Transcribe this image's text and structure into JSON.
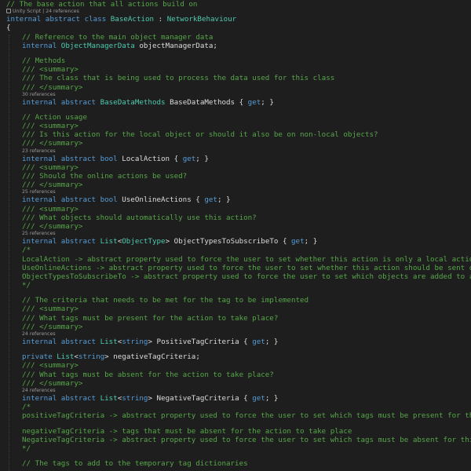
{
  "editor": {
    "colors": {
      "background": "#1e1e1e",
      "comment": "#57a64a",
      "keyword": "#569cd6",
      "type": "#4ec9b0",
      "plain": "#dcdcdc",
      "codelens": "#999999"
    },
    "lines": [
      {
        "kind": "code",
        "indent": 1,
        "tokens": [
          {
            "t": "comment",
            "v": "// The base action that all actions build on"
          }
        ]
      },
      {
        "kind": "lens",
        "indent": 1,
        "icon": "unity-script-icon",
        "text": "Unity Script | 24 references"
      },
      {
        "kind": "code",
        "indent": 1,
        "tokens": [
          {
            "t": "keyword",
            "v": "internal abstract class "
          },
          {
            "t": "type",
            "v": "BaseAction"
          },
          {
            "t": "plain",
            "v": " : "
          },
          {
            "t": "type",
            "v": "NetworkBehaviour"
          }
        ]
      },
      {
        "kind": "code",
        "indent": 1,
        "tokens": [
          {
            "t": "plain",
            "v": "{"
          }
        ]
      },
      {
        "kind": "code",
        "indent": 2,
        "tokens": [
          {
            "t": "comment",
            "v": "// Reference to the main object manager data"
          }
        ]
      },
      {
        "kind": "code",
        "indent": 2,
        "tokens": [
          {
            "t": "keyword",
            "v": "internal "
          },
          {
            "t": "type",
            "v": "ObjectManagerData"
          },
          {
            "t": "plain",
            "v": " objectManagerData;"
          }
        ]
      },
      {
        "kind": "blank"
      },
      {
        "kind": "code",
        "indent": 2,
        "tokens": [
          {
            "t": "comment",
            "v": "// Methods"
          }
        ]
      },
      {
        "kind": "code",
        "indent": 2,
        "tokens": [
          {
            "t": "comment",
            "v": "/// <summary>"
          }
        ]
      },
      {
        "kind": "code",
        "indent": 2,
        "tokens": [
          {
            "t": "comment",
            "v": "/// The class that is being used to process the data used for this class"
          }
        ]
      },
      {
        "kind": "code",
        "indent": 2,
        "tokens": [
          {
            "t": "comment",
            "v": "/// </summary>"
          }
        ]
      },
      {
        "kind": "lens",
        "indent": 2,
        "text": "30 references"
      },
      {
        "kind": "code",
        "indent": 2,
        "tokens": [
          {
            "t": "keyword",
            "v": "internal abstract "
          },
          {
            "t": "type",
            "v": "BaseDataMethods"
          },
          {
            "t": "plain",
            "v": " BaseDataMethods { "
          },
          {
            "t": "keyword",
            "v": "get"
          },
          {
            "t": "plain",
            "v": "; }"
          }
        ]
      },
      {
        "kind": "blank"
      },
      {
        "kind": "code",
        "indent": 2,
        "tokens": [
          {
            "t": "comment",
            "v": "// Action usage"
          }
        ]
      },
      {
        "kind": "code",
        "indent": 2,
        "tokens": [
          {
            "t": "comment",
            "v": "/// <summary>"
          }
        ]
      },
      {
        "kind": "code",
        "indent": 2,
        "tokens": [
          {
            "t": "comment",
            "v": "/// Is this action for the local object or should it also be on non-local objects?"
          }
        ]
      },
      {
        "kind": "code",
        "indent": 2,
        "tokens": [
          {
            "t": "comment",
            "v": "/// </summary>"
          }
        ]
      },
      {
        "kind": "lens",
        "indent": 2,
        "text": "23 references"
      },
      {
        "kind": "code",
        "indent": 2,
        "tokens": [
          {
            "t": "keyword",
            "v": "internal abstract bool "
          },
          {
            "t": "plain",
            "v": "LocalAction { "
          },
          {
            "t": "keyword",
            "v": "get"
          },
          {
            "t": "plain",
            "v": "; }"
          }
        ]
      },
      {
        "kind": "code",
        "indent": 2,
        "tokens": [
          {
            "t": "comment",
            "v": "/// <summary>"
          }
        ]
      },
      {
        "kind": "code",
        "indent": 2,
        "tokens": [
          {
            "t": "comment",
            "v": "/// Should the online actions be used?"
          }
        ]
      },
      {
        "kind": "code",
        "indent": 2,
        "tokens": [
          {
            "t": "comment",
            "v": "/// </summary>"
          }
        ]
      },
      {
        "kind": "lens",
        "indent": 2,
        "text": "25 references"
      },
      {
        "kind": "code",
        "indent": 2,
        "tokens": [
          {
            "t": "keyword",
            "v": "internal abstract bool "
          },
          {
            "t": "plain",
            "v": "UseOnlineActions { "
          },
          {
            "t": "keyword",
            "v": "get"
          },
          {
            "t": "plain",
            "v": "; }"
          }
        ]
      },
      {
        "kind": "code",
        "indent": 2,
        "tokens": [
          {
            "t": "comment",
            "v": "/// <summary>"
          }
        ]
      },
      {
        "kind": "code",
        "indent": 2,
        "tokens": [
          {
            "t": "comment",
            "v": "/// What objects should automatically use this action?"
          }
        ]
      },
      {
        "kind": "code",
        "indent": 2,
        "tokens": [
          {
            "t": "comment",
            "v": "/// </summary>"
          }
        ]
      },
      {
        "kind": "lens",
        "indent": 2,
        "text": "25 references"
      },
      {
        "kind": "code",
        "indent": 2,
        "tokens": [
          {
            "t": "keyword",
            "v": "internal abstract "
          },
          {
            "t": "type",
            "v": "List"
          },
          {
            "t": "plain",
            "v": "<"
          },
          {
            "t": "type",
            "v": "ObjectType"
          },
          {
            "t": "plain",
            "v": "> ObjectTypesToSubscribeTo { "
          },
          {
            "t": "keyword",
            "v": "get"
          },
          {
            "t": "plain",
            "v": "; }"
          }
        ]
      },
      {
        "kind": "code",
        "indent": 2,
        "tokens": [
          {
            "t": "comment",
            "v": "/*"
          }
        ]
      },
      {
        "kind": "code",
        "indent": 2,
        "tokens": [
          {
            "t": "comment",
            "v": "LocalAction -> abstract property used to force the user to set whether this action is only a local action (meaning"
          }
        ]
      },
      {
        "kind": "code",
        "indent": 2,
        "tokens": [
          {
            "t": "comment",
            "v": "UseOnlineActions -> abstract property used to force the user to set whether this action should be sent out to the"
          }
        ]
      },
      {
        "kind": "code",
        "indent": 2,
        "tokens": [
          {
            "t": "comment",
            "v": "ObjectTypesToSubscribeTo -> abstract property used to force the user to set which objects are added to an action"
          }
        ]
      },
      {
        "kind": "code",
        "indent": 2,
        "tokens": [
          {
            "t": "comment",
            "v": "*/"
          }
        ]
      },
      {
        "kind": "blank"
      },
      {
        "kind": "code",
        "indent": 2,
        "tokens": [
          {
            "t": "comment",
            "v": "// The criteria that needs to be met for the tag to be implemented"
          }
        ]
      },
      {
        "kind": "code",
        "indent": 2,
        "tokens": [
          {
            "t": "comment",
            "v": "/// <summary>"
          }
        ]
      },
      {
        "kind": "code",
        "indent": 2,
        "tokens": [
          {
            "t": "comment",
            "v": "/// What tags must be present for the action to take place?"
          }
        ]
      },
      {
        "kind": "code",
        "indent": 2,
        "tokens": [
          {
            "t": "comment",
            "v": "/// </summary>"
          }
        ]
      },
      {
        "kind": "lens",
        "indent": 2,
        "text": "24 references"
      },
      {
        "kind": "code",
        "indent": 2,
        "tokens": [
          {
            "t": "keyword",
            "v": "internal abstract "
          },
          {
            "t": "type",
            "v": "List"
          },
          {
            "t": "plain",
            "v": "<"
          },
          {
            "t": "keyword",
            "v": "string"
          },
          {
            "t": "plain",
            "v": "> PositiveTagCriteria { "
          },
          {
            "t": "keyword",
            "v": "get"
          },
          {
            "t": "plain",
            "v": "; }"
          }
        ]
      },
      {
        "kind": "blank"
      },
      {
        "kind": "code",
        "indent": 2,
        "tokens": [
          {
            "t": "keyword",
            "v": "private "
          },
          {
            "t": "type",
            "v": "List"
          },
          {
            "t": "plain",
            "v": "<"
          },
          {
            "t": "keyword",
            "v": "string"
          },
          {
            "t": "plain",
            "v": "> negativeTagCriteria;"
          }
        ]
      },
      {
        "kind": "code",
        "indent": 2,
        "tokens": [
          {
            "t": "comment",
            "v": "/// <summary>"
          }
        ]
      },
      {
        "kind": "code",
        "indent": 2,
        "tokens": [
          {
            "t": "comment",
            "v": "/// What tags must be absent for the action to take place?"
          }
        ]
      },
      {
        "kind": "code",
        "indent": 2,
        "tokens": [
          {
            "t": "comment",
            "v": "/// </summary>"
          }
        ]
      },
      {
        "kind": "lens",
        "indent": 2,
        "text": "24 references"
      },
      {
        "kind": "code",
        "indent": 2,
        "tokens": [
          {
            "t": "keyword",
            "v": "internal abstract "
          },
          {
            "t": "type",
            "v": "List"
          },
          {
            "t": "plain",
            "v": "<"
          },
          {
            "t": "keyword",
            "v": "string"
          },
          {
            "t": "plain",
            "v": "> NegativeTagCriteria { "
          },
          {
            "t": "keyword",
            "v": "get"
          },
          {
            "t": "plain",
            "v": "; }"
          }
        ]
      },
      {
        "kind": "code",
        "indent": 2,
        "tokens": [
          {
            "t": "comment",
            "v": "/*"
          }
        ]
      },
      {
        "kind": "code",
        "indent": 2,
        "tokens": [
          {
            "t": "comment",
            "v": "positiveTagCriteria -> abstract property used to force the user to set which tags must be present for this action"
          }
        ]
      },
      {
        "kind": "blank"
      },
      {
        "kind": "code",
        "indent": 2,
        "tokens": [
          {
            "t": "comment",
            "v": "negativeTagCriteria -> tags that must be absent for the action to take place"
          }
        ]
      },
      {
        "kind": "code",
        "indent": 2,
        "tokens": [
          {
            "t": "comment",
            "v": "NegativeTagCriteria -> abstract property used to force the user to set which tags must be absent for this action"
          }
        ]
      },
      {
        "kind": "code",
        "indent": 2,
        "tokens": [
          {
            "t": "comment",
            "v": "*/"
          }
        ]
      },
      {
        "kind": "blank"
      },
      {
        "kind": "code",
        "indent": 2,
        "tokens": [
          {
            "t": "comment",
            "v": "// The tags to add to the temporary tag dictionaries"
          }
        ]
      }
    ]
  }
}
